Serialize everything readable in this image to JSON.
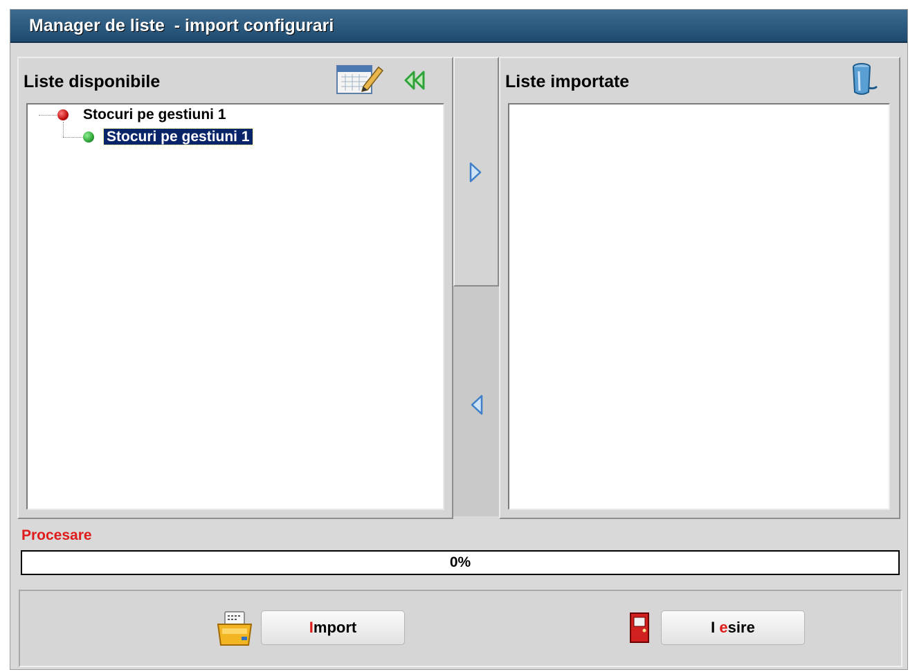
{
  "window": {
    "title": "Manager de liste  - import configurari"
  },
  "left_panel": {
    "title": "Liste disponibile",
    "tree": [
      {
        "label": "Stocuri pe gestiuni 1",
        "level": 0,
        "status": "red"
      },
      {
        "label": "Stocuri pe gestiuni 1",
        "level": 1,
        "status": "green",
        "selected": true
      }
    ],
    "icons": [
      "calendar-edit-icon",
      "double-left-arrow-icon"
    ]
  },
  "right_panel": {
    "title": "Liste importate",
    "icons": [
      "trash-can-icon"
    ]
  },
  "transfer": {
    "icons": [
      "arrow-right-icon",
      "arrow-left-icon"
    ]
  },
  "progress": {
    "label": "Procesare",
    "text": "0%",
    "value": 0
  },
  "buttons": {
    "import": {
      "hotkey": "I",
      "rest": "mport",
      "icon": "printer-icon"
    },
    "exit": {
      "hotkey": "I",
      "hot2": "e",
      "rest": "sire",
      "icon": "exit-door-icon"
    }
  },
  "colors": {
    "title_bar": "#2b5a80",
    "selection": "#0a246a",
    "accent_red": "#e01b1b",
    "accent_green": "#2fa33a"
  }
}
